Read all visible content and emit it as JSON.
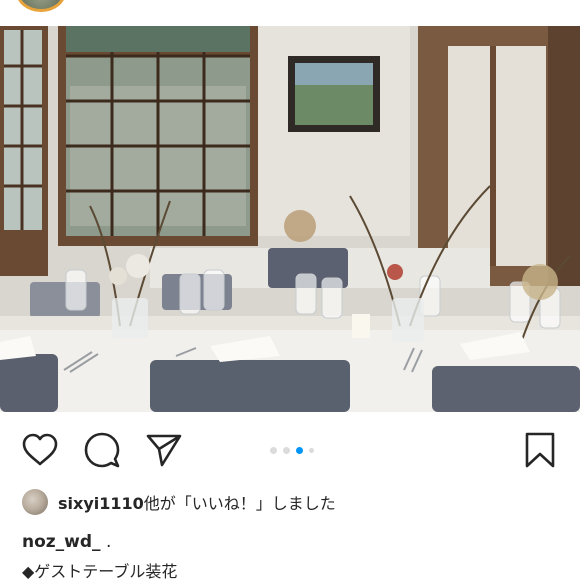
{
  "post": {
    "photo_alt": "",
    "carousel": {
      "count": 4,
      "active_index": 2
    },
    "likes": {
      "username": "sixyi1110",
      "suffix": "他が「いいね！」しました"
    },
    "caption": {
      "username": "noz_wd_",
      "username_trailer": " .",
      "line1": "◆ゲストテーブル装花"
    }
  },
  "icons": {
    "like": "heart-icon",
    "comment": "comment-icon",
    "share": "send-icon",
    "save": "bookmark-icon"
  },
  "colors": {
    "accent": "#0095f6",
    "dot_inactive": "#dbdbdb",
    "text": "#262626",
    "avatar_ring": "#e8a43a"
  }
}
